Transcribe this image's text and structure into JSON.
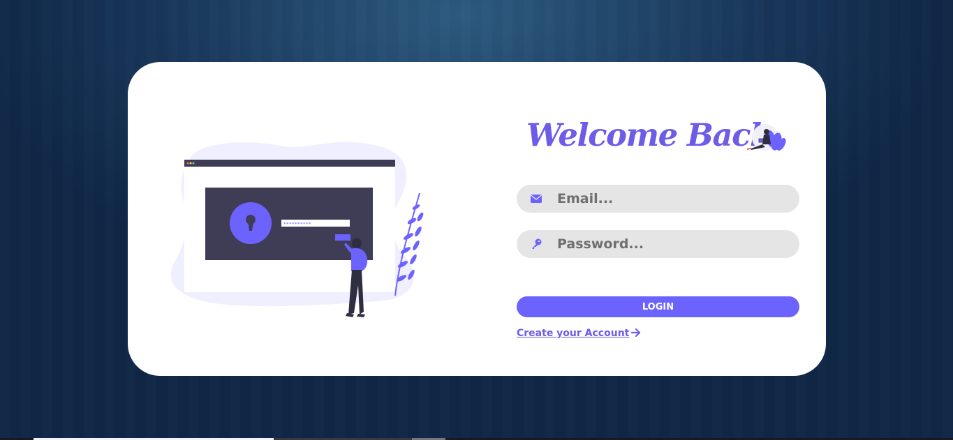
{
  "login": {
    "title": "Welcome Back",
    "email_placeholder": "Email...",
    "password_placeholder": "Password...",
    "login_label": "LOGIN",
    "create_account_label": "Create your Account"
  },
  "icons": {
    "email": "envelope-icon",
    "password": "key-icon",
    "create_account_arrow": "arrow-right-icon"
  },
  "colors": {
    "accent": "#6c63ff",
    "title": "#6c5ce7",
    "field_background": "#e5e5e5",
    "card_background": "#ffffff",
    "page_background": "#183659"
  }
}
